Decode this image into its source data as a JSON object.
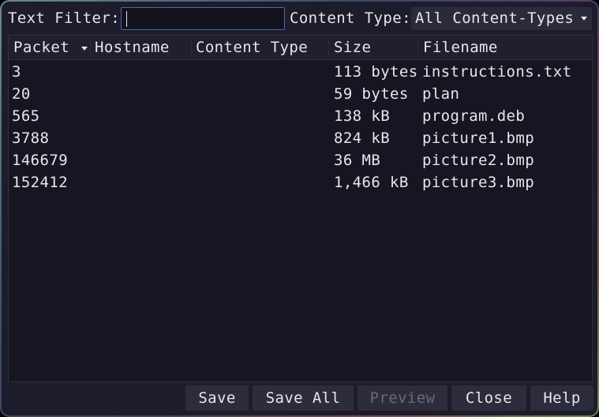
{
  "toolbar": {
    "text_filter_label": "Text Filter:",
    "text_filter_value": "",
    "content_type_label": "Content Type:",
    "content_type_selected": "All Content-Types"
  },
  "table": {
    "columns": [
      "Packet",
      "Hostname",
      "Content Type",
      "Size",
      "Filename"
    ],
    "sort_column": "Packet",
    "rows": [
      {
        "packet": "3",
        "hostname": "",
        "content_type": "",
        "size": "113 bytes",
        "filename": "instructions.txt"
      },
      {
        "packet": "20",
        "hostname": "",
        "content_type": "",
        "size": "59 bytes",
        "filename": "plan"
      },
      {
        "packet": "565",
        "hostname": "",
        "content_type": "",
        "size": "138 kB",
        "filename": "program.deb"
      },
      {
        "packet": "3788",
        "hostname": "",
        "content_type": "",
        "size": "824 kB",
        "filename": "picture1.bmp"
      },
      {
        "packet": "146679",
        "hostname": "",
        "content_type": "",
        "size": "36 MB",
        "filename": "picture2.bmp"
      },
      {
        "packet": "152412",
        "hostname": "",
        "content_type": "",
        "size": "1,466 kB",
        "filename": "picture3.bmp"
      }
    ]
  },
  "buttons": {
    "save": "Save",
    "save_all": "Save All",
    "preview": "Preview",
    "close": "Close",
    "help": "Help"
  },
  "colors": {
    "background": "#1c1c2a",
    "text": "#e6e6ec",
    "disabled_text": "#6a6a78",
    "input_focus_border": "#4a6aa8"
  }
}
